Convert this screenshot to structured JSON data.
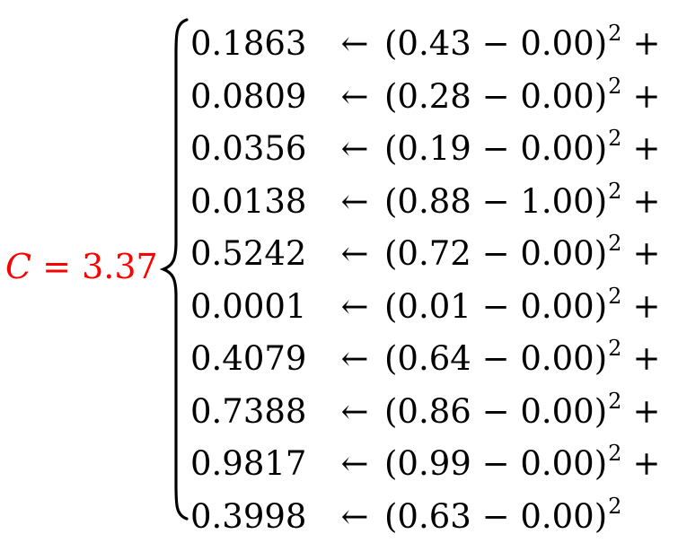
{
  "colors": {
    "cost": "#ff0000",
    "text": "#000000"
  },
  "cost": {
    "var": "C",
    "equals": "=",
    "value": "3.37"
  },
  "arrow": "←",
  "exponent": "2",
  "plus": "+",
  "rows": [
    {
      "value": "0.1863",
      "expr": "(0.43 − 0.00)",
      "plus": "+"
    },
    {
      "value": "0.0809",
      "expr": "(0.28 − 0.00)",
      "plus": "+"
    },
    {
      "value": "0.0356",
      "expr": "(0.19 − 0.00)",
      "plus": "+"
    },
    {
      "value": "0.0138",
      "expr": "(0.88 − 1.00)",
      "plus": "+"
    },
    {
      "value": "0.5242",
      "expr": "(0.72 − 0.00)",
      "plus": "+"
    },
    {
      "value": "0.0001",
      "expr": "(0.01 − 0.00)",
      "plus": "+"
    },
    {
      "value": "0.4079",
      "expr": "(0.64 − 0.00)",
      "plus": "+"
    },
    {
      "value": "0.7388",
      "expr": "(0.86 − 0.00)",
      "plus": "+"
    },
    {
      "value": "0.9817",
      "expr": "(0.99 − 0.00)",
      "plus": "+"
    },
    {
      "value": "0.3998",
      "expr": "(0.63 − 0.00)",
      "plus": ""
    }
  ]
}
